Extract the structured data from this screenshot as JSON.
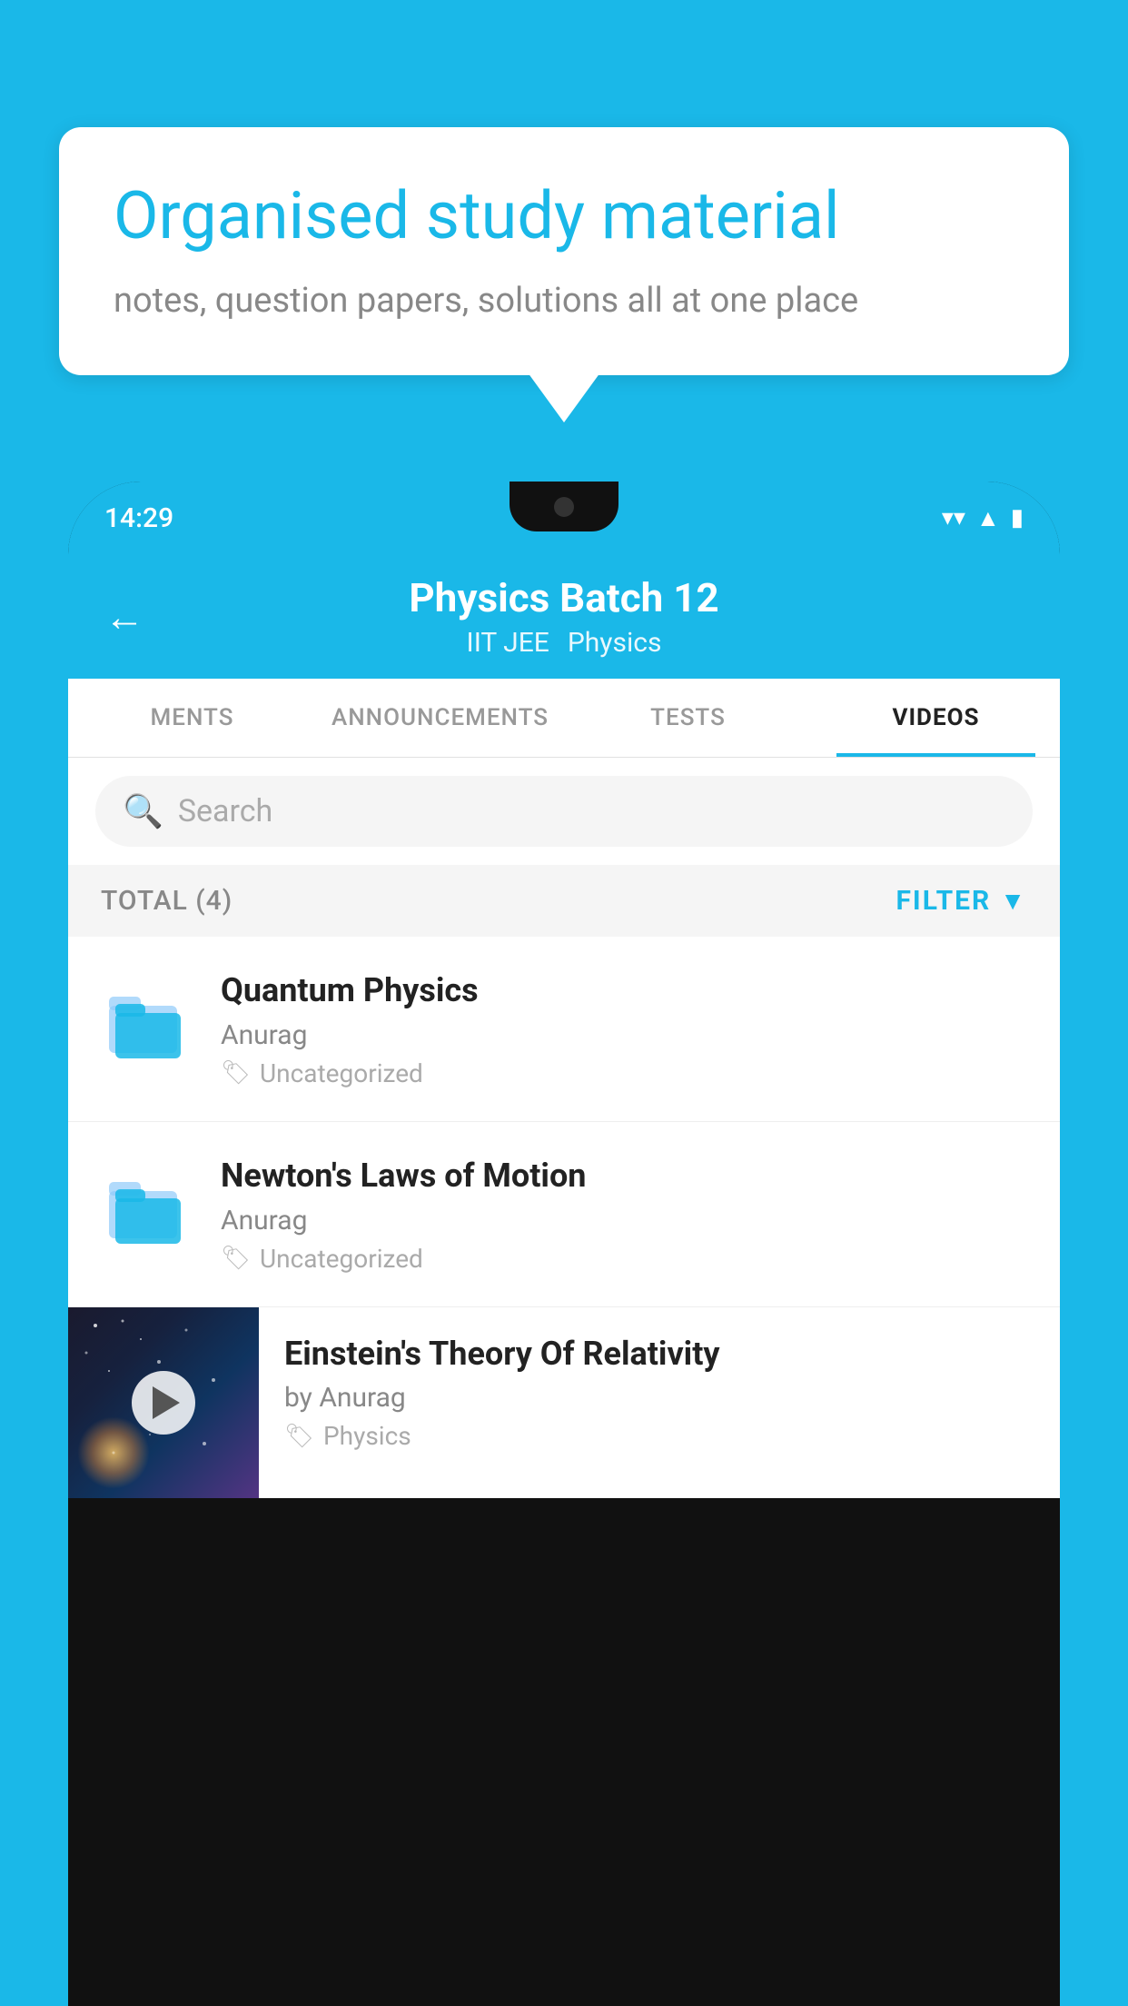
{
  "background": {
    "color": "#1ab8e8"
  },
  "speech_bubble": {
    "title": "Organised study material",
    "subtitle": "notes, question papers, solutions all at one place"
  },
  "phone": {
    "status_bar": {
      "time": "14:29"
    },
    "header": {
      "back_label": "←",
      "title": "Physics Batch 12",
      "subtitle_part1": "IIT JEE",
      "subtitle_part2": "Physics"
    },
    "tabs": [
      {
        "label": "MENTS",
        "active": false
      },
      {
        "label": "ANNOUNCEMENTS",
        "active": false
      },
      {
        "label": "TESTS",
        "active": false
      },
      {
        "label": "VIDEOS",
        "active": true
      }
    ],
    "search": {
      "placeholder": "Search"
    },
    "filter_bar": {
      "total_label": "TOTAL (4)",
      "filter_label": "FILTER"
    },
    "videos": [
      {
        "id": 1,
        "title": "Quantum Physics",
        "author": "Anurag",
        "tag": "Uncategorized",
        "has_thumbnail": false
      },
      {
        "id": 2,
        "title": "Newton's Laws of Motion",
        "author": "Anurag",
        "tag": "Uncategorized",
        "has_thumbnail": false
      },
      {
        "id": 3,
        "title": "Einstein's Theory Of Relativity",
        "author": "by Anurag",
        "tag": "Physics",
        "has_thumbnail": true
      }
    ]
  }
}
